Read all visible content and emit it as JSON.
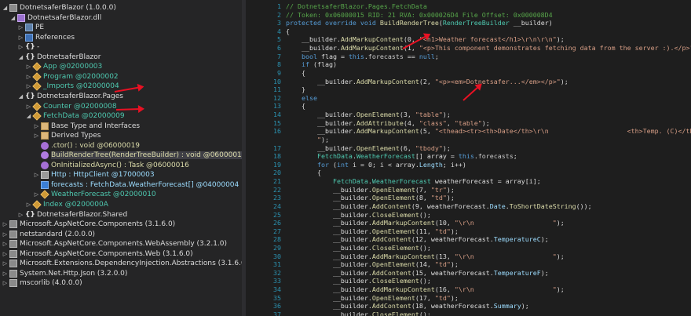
{
  "tree": [
    {
      "text": "DotnetsaferBlazor (1.0.0.0)",
      "indent": 0,
      "icon": "asm",
      "exp": "▲",
      "color": "c-ns"
    },
    {
      "text": "DotnetsaferBlazor.dll",
      "indent": 1,
      "icon": "dll",
      "exp": "▲",
      "color": "c-ns"
    },
    {
      "text": "PE",
      "indent": 2,
      "icon": "pe",
      "exp": "▷",
      "color": "c-ns"
    },
    {
      "text": "References",
      "indent": 2,
      "icon": "ref",
      "exp": "▷",
      "color": "c-ns"
    },
    {
      "text": "-",
      "indent": 2,
      "icon": "ns",
      "exp": "▷",
      "color": "c-ns"
    },
    {
      "text": "DotnetsaferBlazor",
      "indent": 2,
      "icon": "ns",
      "exp": "▲",
      "color": "c-ns"
    },
    {
      "text": "App @02000003",
      "indent": 3,
      "icon": "cls",
      "exp": "▷",
      "color": "c-type"
    },
    {
      "text": "Program @02000002",
      "indent": 3,
      "icon": "cls",
      "exp": "▷",
      "color": "c-type"
    },
    {
      "text": "_Imports @02000004",
      "indent": 3,
      "icon": "cls",
      "exp": "▷",
      "color": "c-type"
    },
    {
      "text": "DotnetsaferBlazor.Pages",
      "indent": 2,
      "icon": "ns",
      "exp": "▲",
      "color": "c-ns"
    },
    {
      "text": "Counter @02000008",
      "indent": 3,
      "icon": "cls",
      "exp": "▷",
      "color": "c-type"
    },
    {
      "text": "FetchData @02000009",
      "indent": 3,
      "icon": "cls",
      "exp": "▲",
      "color": "c-type"
    },
    {
      "text": "Base Type and Interfaces",
      "indent": 4,
      "icon": "folder",
      "exp": "▷",
      "color": "c-ns"
    },
    {
      "text": "Derived Types",
      "indent": 4,
      "icon": "folder",
      "exp": "▷",
      "color": "c-ns"
    },
    {
      "text": ".ctor() : void @06000019",
      "indent": 4,
      "icon": "mth",
      "exp": "",
      "color": "c-meth"
    },
    {
      "text": "BuildRenderTree(RenderTreeBuilder) : void @06000015",
      "indent": 4,
      "icon": "mthsel",
      "exp": "",
      "color": "c-meth",
      "selected": true
    },
    {
      "text": "OnInitializedAsync() : Task @06000016",
      "indent": 4,
      "icon": "mth",
      "exp": "",
      "color": "c-meth"
    },
    {
      "text": "Http : HttpClient @17000003",
      "indent": 4,
      "icon": "prop",
      "exp": "▷",
      "color": "c-field"
    },
    {
      "text": "forecasts : FetchData.WeatherForecast[] @04000004",
      "indent": 4,
      "icon": "fld",
      "exp": "",
      "color": "c-field"
    },
    {
      "text": "WeatherForecast @02000010",
      "indent": 4,
      "icon": "cls",
      "exp": "▷",
      "color": "c-type"
    },
    {
      "text": "Index @0200000A",
      "indent": 3,
      "icon": "cls",
      "exp": "▷",
      "color": "c-type"
    },
    {
      "text": "DotnetsaferBlazor.Shared",
      "indent": 2,
      "icon": "ns",
      "exp": "▷",
      "color": "c-ns"
    },
    {
      "text": "Microsoft.AspNetCore.Components (3.1.6.0)",
      "indent": 0,
      "icon": "asm",
      "exp": "▷",
      "color": "c-ns"
    },
    {
      "text": "netstandard (2.0.0.0)",
      "indent": 0,
      "icon": "asm",
      "exp": "▷",
      "color": "c-ns"
    },
    {
      "text": "Microsoft.AspNetCore.Components.WebAssembly (3.2.1.0)",
      "indent": 0,
      "icon": "asm",
      "exp": "▷",
      "color": "c-ns"
    },
    {
      "text": "Microsoft.AspNetCore.Components.Web (3.1.6.0)",
      "indent": 0,
      "icon": "asm",
      "exp": "▷",
      "color": "c-ns"
    },
    {
      "text": "Microsoft.Extensions.DependencyInjection.Abstractions (3.1.6.0)",
      "indent": 0,
      "icon": "asm",
      "exp": "▷",
      "color": "c-ns"
    },
    {
      "text": "System.Net.Http.Json (3.2.0.0)",
      "indent": 0,
      "icon": "asm",
      "exp": "▷",
      "color": "c-ns"
    },
    {
      "text": "mscorlib (4.0.0.0)",
      "indent": 0,
      "icon": "asm",
      "exp": "▷",
      "color": "c-ns"
    }
  ],
  "code": [
    {
      "n": "1",
      "s": [
        [
          "cm",
          "// DotnetsaferBlazor.Pages.FetchData"
        ]
      ]
    },
    {
      "n": "2",
      "s": [
        [
          "cm",
          "// Token: 0x06000015 RID: 21 RVA: 0x000026D4 File Offset: 0x000008D4"
        ]
      ]
    },
    {
      "n": "3",
      "s": [
        [
          "kw",
          "protected override void "
        ],
        [
          "mt",
          "BuildRenderTree"
        ],
        [
          "pl",
          "("
        ],
        [
          "ty",
          "RenderTreeBuilder"
        ],
        [
          "pl",
          " __builder)"
        ]
      ]
    },
    {
      "n": "4",
      "s": [
        [
          "pl",
          "{"
        ]
      ]
    },
    {
      "n": "5",
      "s": [
        [
          "pl",
          "    __builder."
        ],
        [
          "mt",
          "AddMarkupContent"
        ],
        [
          "pl",
          "(0, "
        ],
        [
          "str",
          "\"<h1>Weather forecast</h1>\\r\\n\\r\\n\""
        ],
        [
          "pl",
          ");"
        ]
      ]
    },
    {
      "n": "6",
      "s": [
        [
          "pl",
          "    __builder."
        ],
        [
          "mt",
          "AddMarkupContent"
        ],
        [
          "pl",
          "(1, "
        ],
        [
          "str",
          "\"<p>This component demonstrates fetching data from the server :).</p>\""
        ],
        [
          "pl",
          ");"
        ]
      ]
    },
    {
      "n": "7",
      "s": [
        [
          "pl",
          "    "
        ],
        [
          "kw",
          "bool"
        ],
        [
          "pl",
          " flag = "
        ],
        [
          "kw",
          "this"
        ],
        [
          "pl",
          "."
        ],
        [
          "fd",
          "forecasts"
        ],
        [
          "pl",
          " == "
        ],
        [
          "kw",
          "null"
        ],
        [
          "pl",
          ";"
        ]
      ]
    },
    {
      "n": "8",
      "s": [
        [
          "pl",
          "    "
        ],
        [
          "kw",
          "if"
        ],
        [
          "pl",
          " (flag)"
        ]
      ]
    },
    {
      "n": "9",
      "s": [
        [
          "pl",
          "    {"
        ]
      ]
    },
    {
      "n": "10",
      "s": [
        [
          "pl",
          "        __builder."
        ],
        [
          "mt",
          "AddMarkupContent"
        ],
        [
          "pl",
          "(2, "
        ],
        [
          "str",
          "\"<p><em>Dotnetsafer...</em></p>\""
        ],
        [
          "pl",
          ");"
        ]
      ]
    },
    {
      "n": "11",
      "s": [
        [
          "pl",
          "    }"
        ]
      ]
    },
    {
      "n": "12",
      "s": [
        [
          "pl",
          "    "
        ],
        [
          "kw",
          "else"
        ]
      ]
    },
    {
      "n": "13",
      "s": [
        [
          "pl",
          "    {"
        ]
      ]
    },
    {
      "n": "14",
      "s": [
        [
          "pl",
          "        __builder."
        ],
        [
          "mt",
          "OpenElement"
        ],
        [
          "pl",
          "(3, "
        ],
        [
          "str",
          "\"table\""
        ],
        [
          "pl",
          ");"
        ]
      ]
    },
    {
      "n": "15",
      "s": [
        [
          "pl",
          "        __builder."
        ],
        [
          "mt",
          "AddAttribute"
        ],
        [
          "pl",
          "(4, "
        ],
        [
          "str",
          "\"class\""
        ],
        [
          "pl",
          ", "
        ],
        [
          "str",
          "\"table\""
        ],
        [
          "pl",
          ");"
        ]
      ]
    },
    {
      "n": "16",
      "s": [
        [
          "pl",
          "        __builder."
        ],
        [
          "mt",
          "AddMarkupContent"
        ],
        [
          "pl",
          "(5, "
        ],
        [
          "str",
          "\"<thead><tr><th>Date</th>\\r\\n                    <th>Temp. (C)</th>\\r\\n"
        ]
      ]
    },
    {
      "n": "",
      "s": [
        [
          "str",
          "        \""
        ],
        [
          "pl",
          ");"
        ]
      ]
    },
    {
      "n": "17",
      "s": [
        [
          "pl",
          "        __builder."
        ],
        [
          "mt",
          "OpenElement"
        ],
        [
          "pl",
          "(6, "
        ],
        [
          "str",
          "\"tbody\""
        ],
        [
          "pl",
          ");"
        ]
      ]
    },
    {
      "n": "18",
      "s": [
        [
          "pl",
          "        "
        ],
        [
          "ty",
          "FetchData"
        ],
        [
          "pl",
          "."
        ],
        [
          "ty",
          "WeatherForecast"
        ],
        [
          "pl",
          "[] array = "
        ],
        [
          "kw",
          "this"
        ],
        [
          "pl",
          "."
        ],
        [
          "fd",
          "forecasts"
        ],
        [
          "pl",
          ";"
        ]
      ]
    },
    {
      "n": "19",
      "s": [
        [
          "pl",
          "        "
        ],
        [
          "kw",
          "for"
        ],
        [
          "pl",
          " ("
        ],
        [
          "kw",
          "int"
        ],
        [
          "pl",
          " i = 0; i < array."
        ],
        [
          "pr",
          "Length"
        ],
        [
          "pl",
          "; i++)"
        ]
      ]
    },
    {
      "n": "20",
      "s": [
        [
          "pl",
          "        {"
        ]
      ]
    },
    {
      "n": "21",
      "s": [
        [
          "pl",
          "            "
        ],
        [
          "ty",
          "FetchData"
        ],
        [
          "pl",
          "."
        ],
        [
          "ty",
          "WeatherForecast"
        ],
        [
          "pl",
          " weatherForecast = array[i];"
        ]
      ]
    },
    {
      "n": "22",
      "s": [
        [
          "pl",
          "            __builder."
        ],
        [
          "mt",
          "OpenElement"
        ],
        [
          "pl",
          "(7, "
        ],
        [
          "str",
          "\"tr\""
        ],
        [
          "pl",
          ");"
        ]
      ]
    },
    {
      "n": "23",
      "s": [
        [
          "pl",
          "            __builder."
        ],
        [
          "mt",
          "OpenElement"
        ],
        [
          "pl",
          "(8, "
        ],
        [
          "str",
          "\"td\""
        ],
        [
          "pl",
          ");"
        ]
      ]
    },
    {
      "n": "24",
      "s": [
        [
          "pl",
          "            __builder."
        ],
        [
          "mt",
          "AddContent"
        ],
        [
          "pl",
          "(9, weatherForecast."
        ],
        [
          "pr",
          "Date"
        ],
        [
          "pl",
          "."
        ],
        [
          "mt",
          "ToShortDateString"
        ],
        [
          "pl",
          "());"
        ]
      ]
    },
    {
      "n": "25",
      "s": [
        [
          "pl",
          "            __builder."
        ],
        [
          "mt",
          "CloseElement"
        ],
        [
          "pl",
          "();"
        ]
      ]
    },
    {
      "n": "26",
      "s": [
        [
          "pl",
          "            __builder."
        ],
        [
          "mt",
          "AddMarkupContent"
        ],
        [
          "pl",
          "(10, "
        ],
        [
          "str",
          "\"\\r\\n                    \""
        ],
        [
          "pl",
          ");"
        ]
      ]
    },
    {
      "n": "27",
      "s": [
        [
          "pl",
          "            __builder."
        ],
        [
          "mt",
          "OpenElement"
        ],
        [
          "pl",
          "(11, "
        ],
        [
          "str",
          "\"td\""
        ],
        [
          "pl",
          ");"
        ]
      ]
    },
    {
      "n": "28",
      "s": [
        [
          "pl",
          "            __builder."
        ],
        [
          "mt",
          "AddContent"
        ],
        [
          "pl",
          "(12, weatherForecast."
        ],
        [
          "pr",
          "TemperatureC"
        ],
        [
          "pl",
          ");"
        ]
      ]
    },
    {
      "n": "29",
      "s": [
        [
          "pl",
          "            __builder."
        ],
        [
          "mt",
          "CloseElement"
        ],
        [
          "pl",
          "();"
        ]
      ]
    },
    {
      "n": "30",
      "s": [
        [
          "pl",
          "            __builder."
        ],
        [
          "mt",
          "AddMarkupContent"
        ],
        [
          "pl",
          "(13, "
        ],
        [
          "str",
          "\"\\r\\n                    \""
        ],
        [
          "pl",
          ");"
        ]
      ]
    },
    {
      "n": "31",
      "s": [
        [
          "pl",
          "            __builder."
        ],
        [
          "mt",
          "OpenElement"
        ],
        [
          "pl",
          "(14, "
        ],
        [
          "str",
          "\"td\""
        ],
        [
          "pl",
          ");"
        ]
      ]
    },
    {
      "n": "32",
      "s": [
        [
          "pl",
          "            __builder."
        ],
        [
          "mt",
          "AddContent"
        ],
        [
          "pl",
          "(15, weatherForecast."
        ],
        [
          "pr",
          "TemperatureF"
        ],
        [
          "pl",
          ");"
        ]
      ]
    },
    {
      "n": "33",
      "s": [
        [
          "pl",
          "            __builder."
        ],
        [
          "mt",
          "CloseElement"
        ],
        [
          "pl",
          "();"
        ]
      ]
    },
    {
      "n": "34",
      "s": [
        [
          "pl",
          "            __builder."
        ],
        [
          "mt",
          "AddMarkupContent"
        ],
        [
          "pl",
          "(16, "
        ],
        [
          "str",
          "\"\\r\\n                    \""
        ],
        [
          "pl",
          ");"
        ]
      ]
    },
    {
      "n": "35",
      "s": [
        [
          "pl",
          "            __builder."
        ],
        [
          "mt",
          "OpenElement"
        ],
        [
          "pl",
          "(17, "
        ],
        [
          "str",
          "\"td\""
        ],
        [
          "pl",
          ");"
        ]
      ]
    },
    {
      "n": "36",
      "s": [
        [
          "pl",
          "            __builder."
        ],
        [
          "mt",
          "AddContent"
        ],
        [
          "pl",
          "(18, weatherForecast."
        ],
        [
          "pr",
          "Summary"
        ],
        [
          "pl",
          ");"
        ]
      ]
    },
    {
      "n": "37",
      "s": [
        [
          "pl",
          "            __builder."
        ],
        [
          "mt",
          "CloseElement"
        ],
        [
          "pl",
          "();"
        ]
      ]
    }
  ],
  "colors": {
    "arrow": "#e81123",
    "selection": "#3f3f46"
  }
}
